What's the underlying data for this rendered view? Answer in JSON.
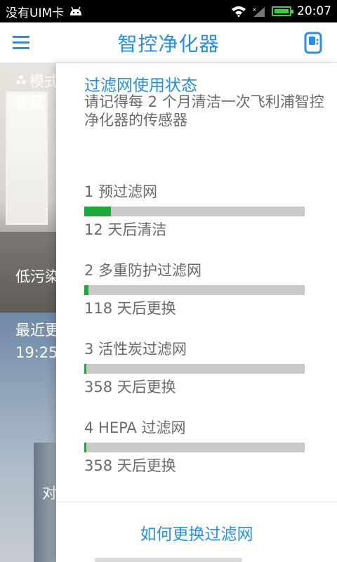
{
  "status_bar": {
    "carrier": "没有UIM卡",
    "time": "20:07",
    "icons": [
      "android-icon",
      "wifi-icon",
      "signal-icon",
      "battery-icon"
    ],
    "battery_color": "#3fcf3f"
  },
  "header": {
    "title": "智控净化器",
    "menu_icon": "menu-icon",
    "device_icon": "device-icon",
    "accent_color": "#2a8fdc"
  },
  "background_page": {
    "mode_label": "模式",
    "speed_label": "速度",
    "pollution_label": "低污染",
    "recent_label": "最近更",
    "recent_time": "19:25",
    "bottom_label": "对"
  },
  "panel": {
    "title": "过滤网使用状态",
    "description": "请记得每 2 个月清洁一次飞利浦智控净化器的传感器",
    "filters": [
      {
        "name": "1 预过滤网",
        "progress": 0.12,
        "status": "12 天后清洁"
      },
      {
        "name": "2 多重防护过滤网",
        "progress": 0.02,
        "status": "118 天后更换"
      },
      {
        "name": "3 活性炭过滤网",
        "progress": 0.005,
        "status": "358 天后更换"
      },
      {
        "name": "4 HEPA 过滤网",
        "progress": 0.005,
        "status": "358 天后更换"
      }
    ],
    "progress_color": "#1fa83a",
    "track_color": "#c9c9c9",
    "help_link": "如何更换过滤网"
  }
}
